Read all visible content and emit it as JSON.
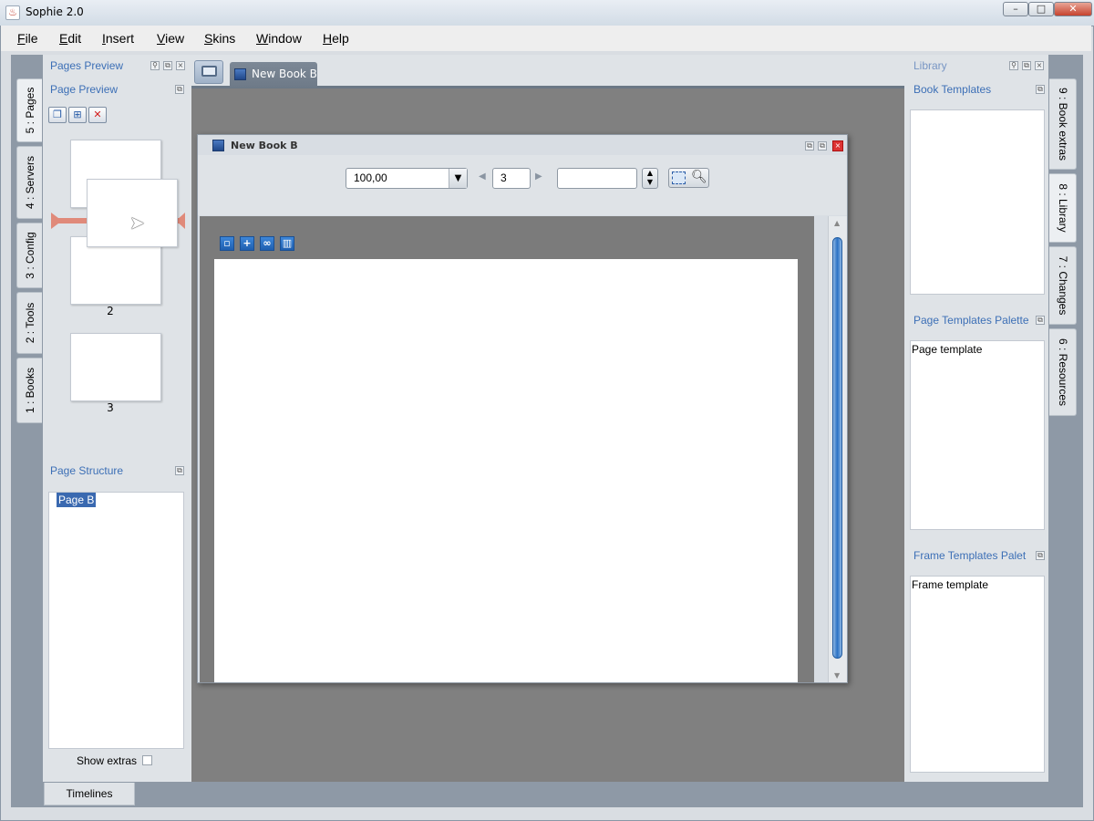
{
  "window": {
    "title": "Sophie 2.0",
    "controls": {
      "minimize": "–",
      "maximize": "□",
      "close": "✕"
    }
  },
  "menu": [
    "File",
    "Edit",
    "Insert",
    "View",
    "Skins",
    "Window",
    "Help"
  ],
  "left_tabs": [
    "5 : Pages",
    "4 : Servers",
    "3 : Config",
    "2 : Tools",
    "1 : Books"
  ],
  "left_panel": {
    "header": "Pages Preview",
    "page_preview": {
      "title": "Page Preview",
      "toolbar": [
        "copy-page",
        "add-page",
        "delete-page"
      ],
      "delete_glyph": "✕"
    },
    "thumbnails": [
      "2",
      "3"
    ],
    "page_structure": {
      "title": "Page Structure",
      "items": [
        "Page B"
      ]
    },
    "show_extras_label": "Show extras"
  },
  "editor": {
    "tab_label": "New Book B",
    "doc_window_title": "New Book B",
    "zoom_value": "100,00",
    "page_number": "3",
    "page_field": "",
    "canvas_tools": [
      "new-page",
      "add",
      "link",
      "chart"
    ]
  },
  "right_panel": {
    "header": "Library",
    "sections": [
      {
        "title": "Book Templates",
        "items": []
      },
      {
        "title": "Page Templates Palette",
        "items": [
          "Page template"
        ]
      },
      {
        "title": "Frame Templates Palet",
        "items": [
          "Frame template"
        ]
      }
    ]
  },
  "right_tabs": [
    "9 : Book extras",
    "8 : Library",
    "7 : Changes",
    "6 : Resources"
  ],
  "bottom": {
    "timelines_label": "Timelines"
  },
  "colors": {
    "accent": "#3c6fb6",
    "selection": "#3a69b0",
    "scroll": "#2a71c4",
    "editor_bg": "#808080"
  }
}
